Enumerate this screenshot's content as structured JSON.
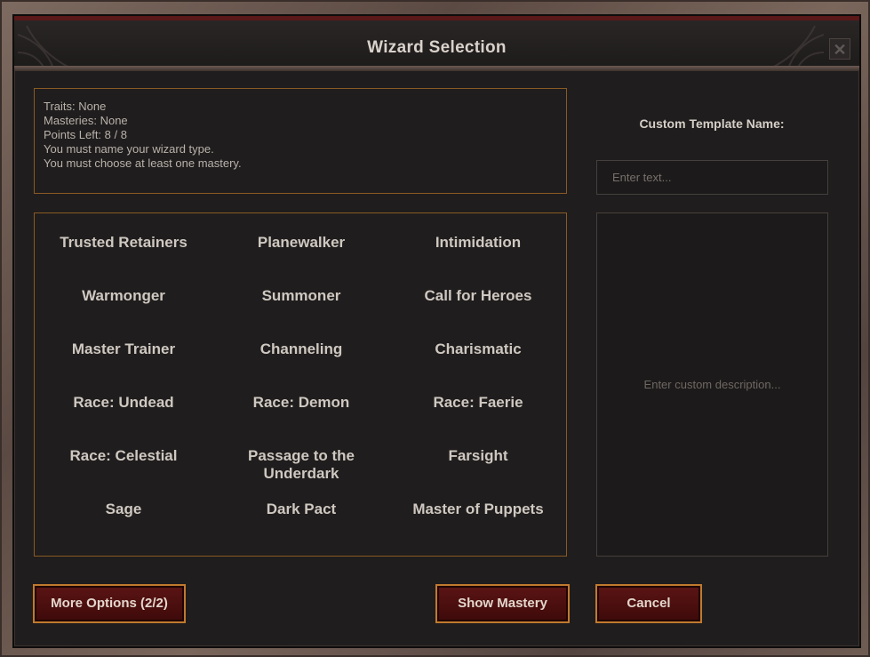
{
  "window": {
    "title": "Wizard Selection",
    "close_glyph": "✕"
  },
  "info": {
    "lines": [
      "Traits: None",
      "Masteries: None",
      "Points Left: 8 / 8",
      "You must name your wizard type.",
      "You must choose at least one mastery."
    ]
  },
  "template": {
    "label": "Custom Template Name:",
    "name_value": "",
    "name_placeholder": "Enter text...",
    "description_placeholder": "Enter custom description..."
  },
  "options": [
    [
      "Trusted Retainers",
      "Planewalker",
      "Intimidation"
    ],
    [
      "Warmonger",
      "Summoner",
      "Call for Heroes"
    ],
    [
      "Master Trainer",
      "Channeling",
      "Charismatic"
    ],
    [
      "Race: Undead",
      "Race: Demon",
      "Race: Faerie"
    ],
    [
      "Race: Celestial",
      "Passage to the Underdark",
      "Farsight"
    ],
    [
      "Sage",
      "Dark Pact",
      "Master of Puppets"
    ]
  ],
  "buttons": {
    "more_options": "More Options (2/2)",
    "show_mastery": "Show Mastery",
    "cancel": "Cancel"
  },
  "colors": {
    "accent_border": "#8a5a24",
    "button_bg": "#5b1414",
    "button_border": "#c07a2e",
    "title_bar_stripe": "#5a1818"
  }
}
